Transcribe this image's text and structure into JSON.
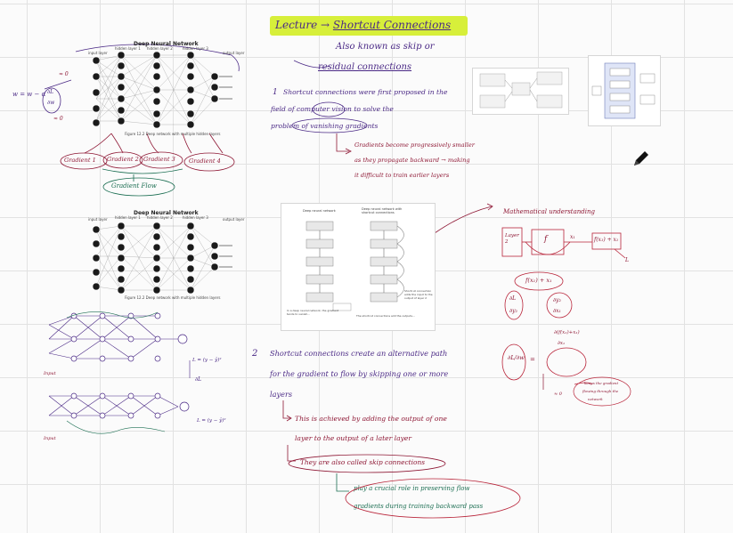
{
  "title": {
    "lecture": "Lecture",
    "arrow": "→",
    "topic": "Shortcut Connections"
  },
  "aka": {
    "line1": "Also known as skip or",
    "line2": "residual connections"
  },
  "point1": {
    "number": "1",
    "line1": "Shortcut connections were first proposed in the",
    "line2": "field of computer vision to solve the",
    "line3": "problem of vanishing gradients",
    "sub1": "Gradients become progressively smaller",
    "sub2": "as they propagate backward → making",
    "sub3": "it difficult to train earlier layers"
  },
  "point2": {
    "number": "2",
    "line1": "Shortcut connections create an alternative path",
    "line2": "for the gradient to flow by skipping one or more",
    "line3": "layers",
    "sub1": "This is achieved by adding the output of one",
    "sub2": "layer to the output of a later layer",
    "sub3": "They are also called skip connections",
    "sub4": "play a crucial role in preserving flow",
    "sub5": "gradients during training backward pass"
  },
  "nn1": {
    "title": "Deep Neural Network",
    "input_label": "input layer",
    "hidden1": "hidden layer 1",
    "hidden2": "hidden layer 2",
    "hidden3": "hidden layer 3",
    "output_label": "output layer",
    "caption": "Figure 12.2 Deep network with multiple hidden layers"
  },
  "nn2": {
    "title": "Deep Neural Network",
    "input_label": "input layer",
    "hidden1": "hidden layer 1",
    "hidden2": "hidden layer 2",
    "hidden3": "hidden layer 3",
    "output_label": "output layer",
    "caption": "Figure 12.2 Deep network with multiple hidden layers"
  },
  "gradients": {
    "g1": "Gradient 1",
    "g2": "Gradient 2",
    "g3": "Gradient 3",
    "g4": "Gradient 4",
    "flow": "Gradient Flow"
  },
  "update_rule": {
    "lhs": "w = w − α",
    "frac_num": "∂L",
    "frac_den": "∂w",
    "zero_top": "≈ 0",
    "zero_bottom": "≈ 0"
  },
  "math": {
    "heading": "Mathematical understanding",
    "layer_label": "Layer 2",
    "func": "f",
    "input": "x₁",
    "output": "f(x₁) + x₁",
    "loss": "L",
    "expr1": "f(x₁) + x₁",
    "dl_top": "∂L",
    "dl_bot": "∂y₂",
    "dy_top": "∂y₂",
    "dy_bot": "∂x₁",
    "partial_expr": "∂(f(x₁)+x₁)",
    "partial_den": "∂x₁",
    "eq": "=",
    "dL_dw": "∂L/∂w",
    "note1": "keeps the gradient",
    "note2": "flowing through the",
    "note3": "network",
    "approx": "≈ 0"
  },
  "diagram_center": {
    "left_title": "Deep neural network",
    "right_title": "Deep neural network with shortcut connections",
    "left_caption": "In a deep neural network, the gradient tends to vanish...",
    "right_caption": "The shortcut connections add the outputs...",
    "note": "Shortcut connection adds the input to the output of layer 2"
  },
  "small_nets": {
    "loss1": "L = (y − ŷ)²",
    "loss2": "L = (y − ŷ)²",
    "arrow_label": "∂L",
    "input1": "Input",
    "input2": "Input"
  },
  "colors": {
    "purple": "#4b2a86",
    "maroon": "#8e1734",
    "green": "#1b6e52",
    "highlight": "#d7ef3a"
  }
}
